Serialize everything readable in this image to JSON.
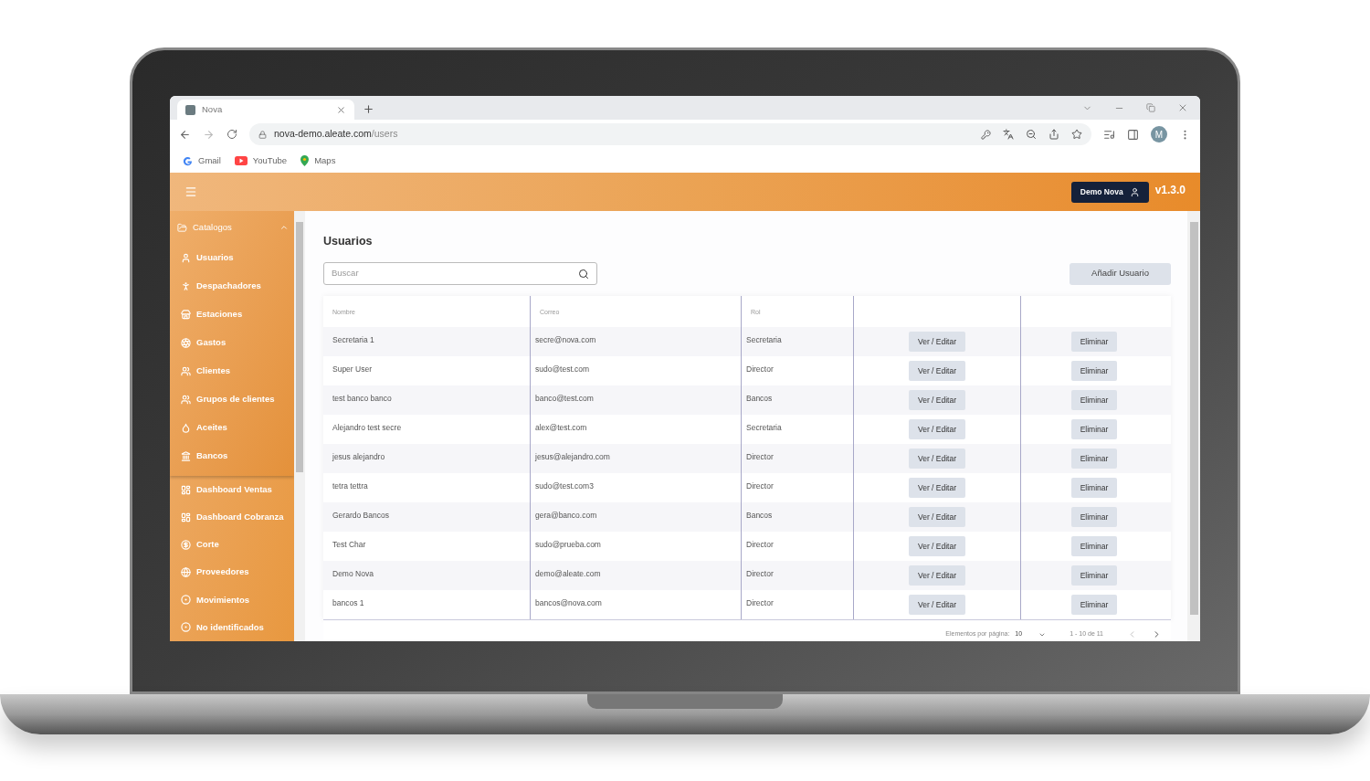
{
  "browser": {
    "tab": {
      "title": "Nova"
    },
    "url": {
      "host": "nova-demo.aleate.com",
      "path": "/users"
    },
    "profile": "M",
    "bookmarks": [
      {
        "label": "Gmail",
        "kind": "gmail"
      },
      {
        "label": "YouTube",
        "kind": "youtube"
      },
      {
        "label": "Maps",
        "kind": "maps"
      }
    ]
  },
  "header": {
    "user_button": "Demo Nova",
    "version": "v1.3.0"
  },
  "sidebar": {
    "group": {
      "label": "Catalogos",
      "expanded": true,
      "children": [
        {
          "label": "Usuarios"
        },
        {
          "label": "Despachadores"
        },
        {
          "label": "Estaciones"
        },
        {
          "label": "Gastos"
        },
        {
          "label": "Clientes"
        },
        {
          "label": "Grupos de clientes"
        },
        {
          "label": "Aceites"
        },
        {
          "label": "Bancos"
        }
      ]
    },
    "items": [
      {
        "label": "Dashboard Ventas"
      },
      {
        "label": "Dashboard Cobranza"
      },
      {
        "label": "Corte"
      },
      {
        "label": "Proveedores"
      },
      {
        "label": "Movimientos"
      },
      {
        "label": "No identificados"
      }
    ]
  },
  "page": {
    "title": "Usuarios",
    "search": {
      "placeholder": "Buscar"
    },
    "add_button": "Añadir Usuario"
  },
  "table": {
    "columns": [
      "Nombre",
      "Correo",
      "Rol"
    ],
    "rows": [
      {
        "name": "Secretaria 1",
        "email": "secre@nova.com",
        "role": "Secretaria",
        "edit": "Ver / Editar",
        "delete": "Eliminar"
      },
      {
        "name": "Super User",
        "email": "sudo@test.com",
        "role": "Director",
        "edit": "Ver / Editar",
        "delete": "Eliminar"
      },
      {
        "name": "test banco banco",
        "email": "banco@test.com",
        "role": "Bancos",
        "edit": "Ver / Editar",
        "delete": "Eliminar"
      },
      {
        "name": "Alejandro test secre",
        "email": "alex@test.com",
        "role": "Secretaria",
        "edit": "Ver / Editar",
        "delete": "Eliminar"
      },
      {
        "name": "jesus alejandro",
        "email": "jesus@alejandro.com",
        "role": "Director",
        "edit": "Ver / Editar",
        "delete": "Eliminar"
      },
      {
        "name": "tetra tettra",
        "email": "sudo@test.com3",
        "role": "Director",
        "edit": "Ver / Editar",
        "delete": "Eliminar"
      },
      {
        "name": "Gerardo Bancos",
        "email": "gera@banco.com",
        "role": "Bancos",
        "edit": "Ver / Editar",
        "delete": "Eliminar"
      },
      {
        "name": "Test Char",
        "email": "sudo@prueba.com",
        "role": "Director",
        "edit": "Ver / Editar",
        "delete": "Eliminar"
      },
      {
        "name": "Demo Nova",
        "email": "demo@aleate.com",
        "role": "Director",
        "edit": "Ver / Editar",
        "delete": "Eliminar"
      },
      {
        "name": "bancos 1",
        "email": "bancos@nova.com",
        "role": "Director",
        "edit": "Ver / Editar",
        "delete": "Eliminar"
      }
    ],
    "paginator": {
      "label": "Elementos por página:",
      "page_size": "10",
      "range": "1 - 10 de 11"
    }
  }
}
